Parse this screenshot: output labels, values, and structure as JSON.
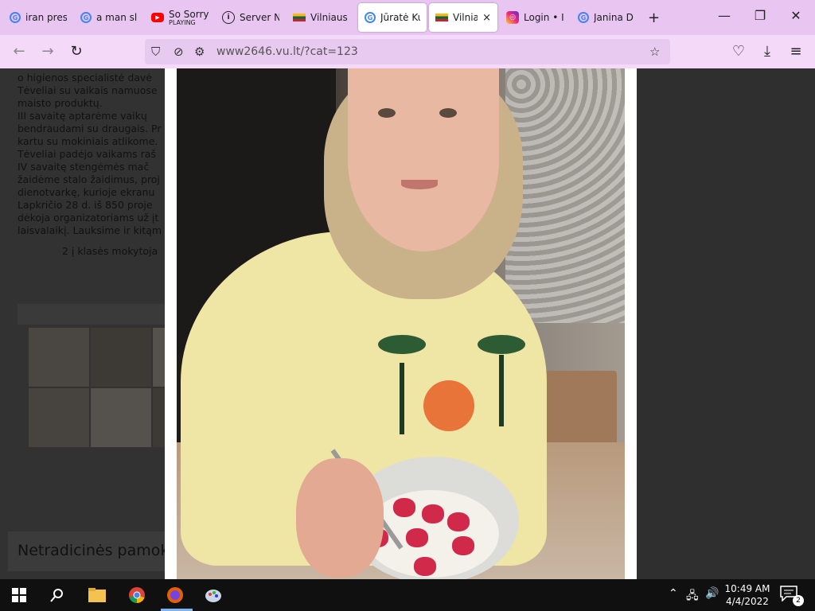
{
  "browser": {
    "tabs": [
      {
        "label": "iran pres",
        "icon": "google-icon",
        "active": false
      },
      {
        "label": "a man sl",
        "icon": "google-icon",
        "active": false
      },
      {
        "label": "So Sorry",
        "sublabel": "PLAYING",
        "icon": "youtube-icon",
        "active": false
      },
      {
        "label": "Server N",
        "icon": "info-icon",
        "active": false
      },
      {
        "label": "Vilniaus",
        "icon": "lithuanian-flag-icon",
        "active": false
      },
      {
        "label": "Jūratė Ku",
        "icon": "google-icon",
        "active": true
      },
      {
        "label": "Vilniau",
        "icon": "lithuanian-flag-icon",
        "active": true,
        "close": "×"
      },
      {
        "label": "Login • I",
        "icon": "instagram-icon",
        "active": false
      },
      {
        "label": "Janina D",
        "icon": "google-icon",
        "active": false
      }
    ],
    "new_tab": "+",
    "window_controls": {
      "minimize": "—",
      "restore": "❐",
      "close": "✕"
    },
    "url": "www2646.vu.lt/?cat=123"
  },
  "page": {
    "article_lines": [
      "o higienos specialistė davė",
      "Tėveliai su vaikais namuose",
      "maisto produktų.",
      "  III savaitę aptarėme vaikų",
      "bendraudami su draugais. Pr",
      "kartu su mokiniais atlikome.",
      "Tėveliai padėjo vaikams raš",
      "  IV savaitę stengėmės mač",
      "žaidėme stalo žaidimus, proj",
      "dienotvarkę, kurioje ekranu",
      "  Lapkričio 28 d. iš 850 proje",
      "dėkoja organizatoriams už įt",
      "laisvalaikį. Lauksime ir kitąm"
    ],
    "signature": "2 į klasės mokytoja",
    "section_heading": "Netradicinės pamok"
  },
  "taskbar": {
    "clock_time": "10:49 AM",
    "clock_date": "4/4/2022",
    "notification_count": "2"
  },
  "colors": {
    "tab_strip": "#e9c6f2",
    "nav_bar": "#f4daf8",
    "url_bar": "#e8c9f0",
    "overlay": "#2f2f2f",
    "taskbar": "#101010"
  }
}
